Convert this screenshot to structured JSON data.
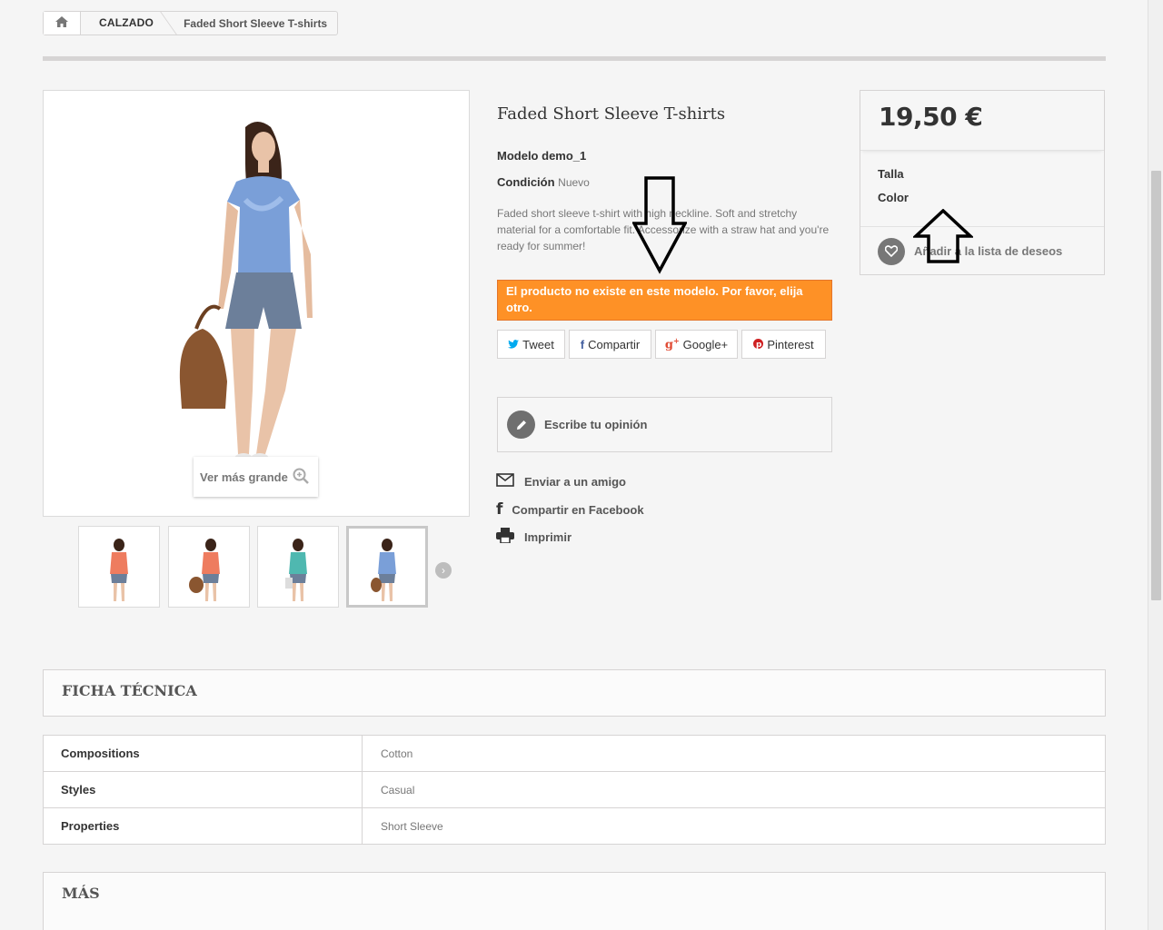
{
  "breadcrumb": {
    "home_icon": "home-icon",
    "category": "CALZADO",
    "current": "Faded Short Sleeve T-shirts"
  },
  "product": {
    "title": "Faded Short Sleeve T-shirts",
    "reference_label": "Modelo",
    "reference_value": "demo_1",
    "condition_label": "Condición",
    "condition_value": "Nuevo",
    "description": "Faded short sleeve t-shirt with high neckline. Soft and stretchy material for a comfortable fit. Accessorize with a straw hat and you're ready for summer!",
    "warning": "El producto no existe en este modelo. Por favor, elija otro.",
    "zoom_label": "Ver más grande"
  },
  "share": {
    "tweet": "Tweet",
    "facebook": "Compartir",
    "google": "Google+",
    "pinterest": "Pinterest"
  },
  "review": {
    "label": "Escribe tu opinión"
  },
  "links": {
    "send_friend": "Enviar a un amigo",
    "share_facebook": "Compartir en Facebook",
    "print": "Imprimir"
  },
  "buybox": {
    "price": "19,50 €",
    "attr_size": "Talla",
    "attr_color": "Color",
    "wishlist": "Añadir a la lista de deseos"
  },
  "datasheet": {
    "heading": "FICHA TÉCNICA",
    "rows": [
      {
        "key": "Compositions",
        "value": "Cotton"
      },
      {
        "key": "Styles",
        "value": "Casual"
      },
      {
        "key": "Properties",
        "value": "Short Sleeve"
      }
    ]
  },
  "more": {
    "heading": "MÁS"
  },
  "colors": {
    "warning": "#fe9126",
    "twitter": "#00aaf0",
    "facebook": "#435f9f",
    "google": "#e04b34",
    "pinterest": "#ce1f21"
  }
}
